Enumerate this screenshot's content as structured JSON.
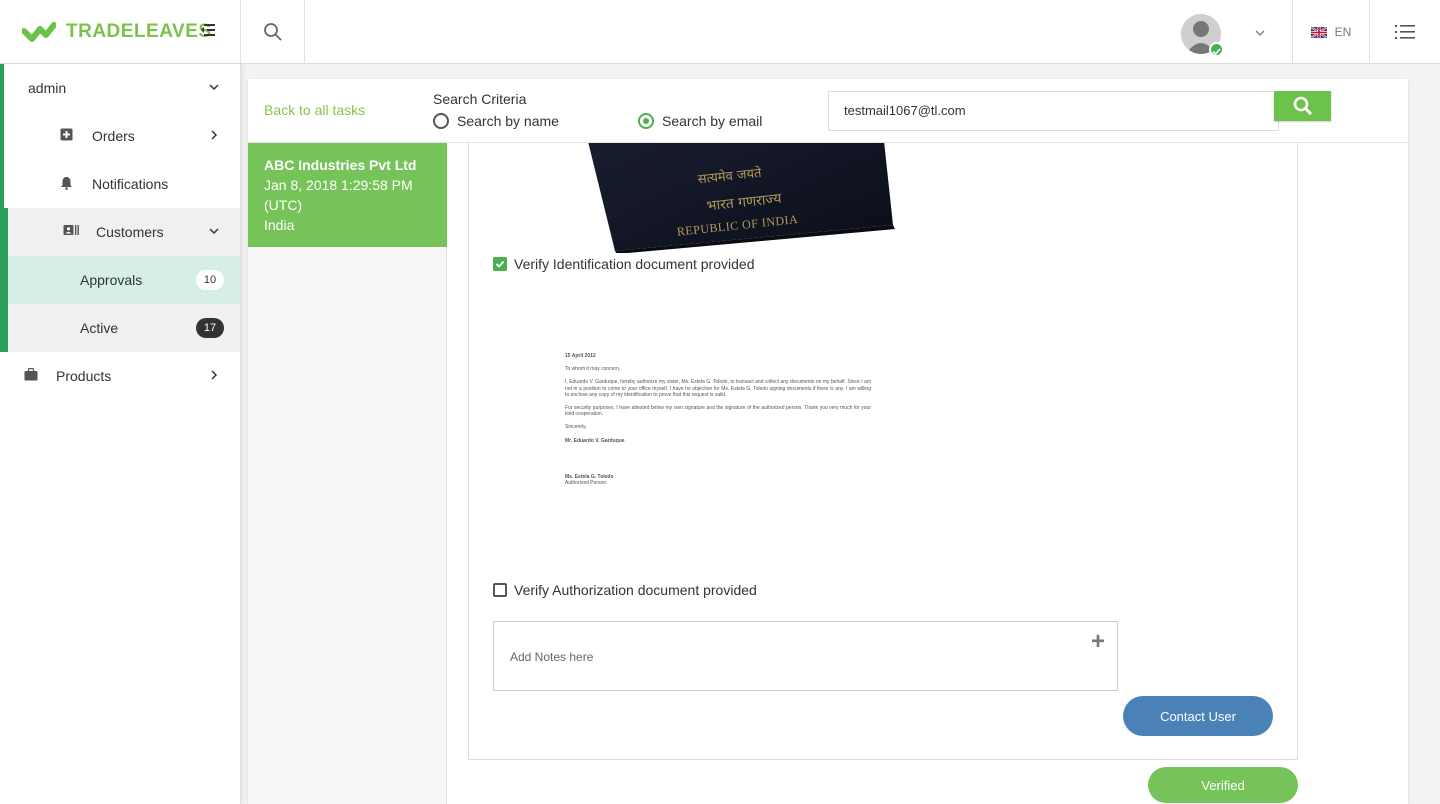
{
  "brand": {
    "name_part1": "TRADE",
    "name_part2": "LEAVES"
  },
  "header": {
    "language": "EN"
  },
  "sidebar": {
    "admin_label": "admin",
    "items": [
      {
        "label": "Orders"
      },
      {
        "label": "Notifications"
      },
      {
        "label": "Customers"
      },
      {
        "label": "Approvals",
        "count": "10"
      },
      {
        "label": "Active",
        "count": "17"
      },
      {
        "label": "Products"
      }
    ]
  },
  "search": {
    "back_link": "Back to all tasks",
    "criteria_title": "Search Criteria",
    "option_name": "Search by name",
    "option_email": "Search by email",
    "selected_option": "Search by email",
    "email_value": "testmail1067@tl.com"
  },
  "task": {
    "company": "ABC Industries Pvt Ltd",
    "date": "Jan 8, 2018 1:29:58 PM",
    "timezone": "(UTC)",
    "country": "India"
  },
  "verification": {
    "passport_text_hindi": "भारत गणराज्य",
    "passport_motto": "सत्यमेव जयते",
    "passport_text_en": "REPUBLIC OF INDIA",
    "id_check_label": "Verify Identification document provided",
    "id_checked": true,
    "letter": {
      "date": "15 April 2012",
      "salutation": "To whom it may concern,",
      "para1": "I, Eduardo V. Garduque, hereby authorize my sister, Ms. Estela G. Toledo, to transact and collect any documents on my behalf. Since I am not in a position to come to your office myself, I have no objection for Ms. Estela G. Toledo signing documents if there is any. I am willing to enclose any copy of my identification to prove that this request is valid.",
      "para2": "For security purposes, I have attested below my own signature and the signature of the authorized person. Thank you very much for your kind cooperation.",
      "closing": "Sincerely,",
      "signer": "Mr. Eduardo V. Garduque",
      "authorized": "Ms. Estela G. Toledo",
      "authorized_role": "Authorized Person"
    },
    "auth_check_label": "Verify Authorization document provided",
    "auth_checked": false,
    "notes_placeholder": "Add Notes here",
    "contact_button": "Contact User",
    "verified_button": "Verified"
  }
}
